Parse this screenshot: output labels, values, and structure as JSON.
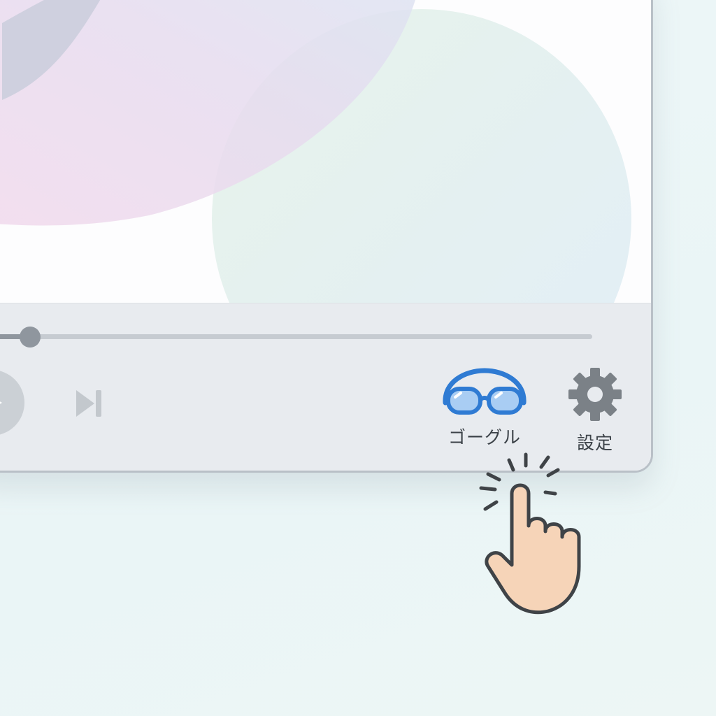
{
  "player": {
    "seek": {
      "progress": 0.09
    },
    "controls": {
      "play_icon": "play-icon",
      "next_icon": "skip-next-icon"
    },
    "tools": [
      {
        "label": "ゴーグル",
        "icon": "goggles-icon",
        "color": "#2f7bd3"
      },
      {
        "label": "設定",
        "icon": "gear-icon",
        "color": "#7b8187"
      }
    ]
  },
  "pointer": {
    "icon": "tap-hand-icon"
  }
}
